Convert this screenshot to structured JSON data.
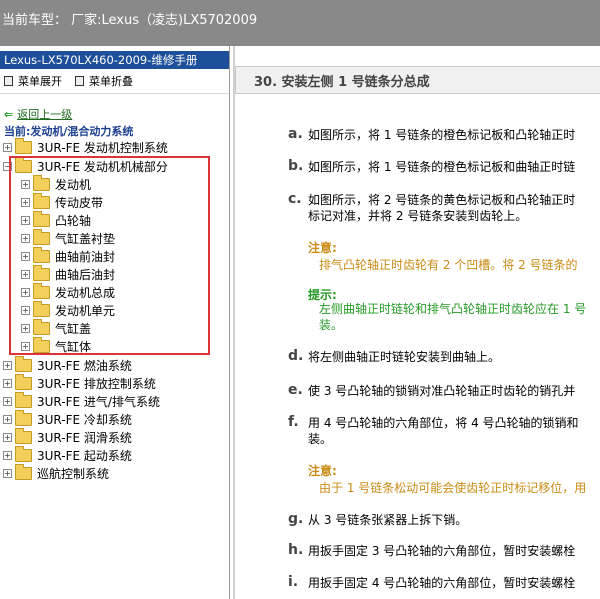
{
  "header": {
    "title": "当前车型： 厂家:Lexus（凌志)LX5702009"
  },
  "sidebar": {
    "manual_title": "Lexus-LX570LX460-2009-维修手册",
    "expand_label": "菜单展开",
    "collapse_label": "菜单折叠",
    "back_label": "返回上一级",
    "current_label": "当前:发动机/混合动力系统",
    "tree": [
      {
        "label": "3UR-FE 发动机控制系统"
      },
      {
        "label": "3UR-FE 发动机机械部分"
      },
      {
        "label": "发动机"
      },
      {
        "label": "传动皮带"
      },
      {
        "label": "凸轮轴"
      },
      {
        "label": "气缸盖衬垫"
      },
      {
        "label": "曲轴前油封"
      },
      {
        "label": "曲轴后油封"
      },
      {
        "label": "发动机总成"
      },
      {
        "label": "发动机单元"
      },
      {
        "label": "气缸盖"
      },
      {
        "label": "气缸体"
      },
      {
        "label": "3UR-FE 燃油系统"
      },
      {
        "label": "3UR-FE 排放控制系统"
      },
      {
        "label": "3UR-FE 进气/排气系统"
      },
      {
        "label": "3UR-FE 冷却系统"
      },
      {
        "label": "3UR-FE 润滑系统"
      },
      {
        "label": "3UR-FE 起动系统"
      },
      {
        "label": "巡航控制系统"
      }
    ]
  },
  "content": {
    "section_title": "30. 安装左侧 1 号链条分总成",
    "steps": [
      {
        "letter": "a.",
        "lines": [
          "如图所示，将 1 号链条的橙色标记板和凸轮轴正时"
        ]
      },
      {
        "letter": "b.",
        "lines": [
          "如图所示，将 1 号链条的橙色标记板和曲轴正时链"
        ]
      },
      {
        "letter": "c.",
        "lines": [
          "如图所示，将 2 号链条的黄色标记板和凸轮轴正时",
          "标记对准，并将 2 号链条安装到齿轮上。"
        ]
      },
      {
        "letter": "d.",
        "lines": [
          "将左侧曲轴正时链轮安装到曲轴上。"
        ]
      },
      {
        "letter": "e.",
        "lines": [
          "使 3 号凸轮轴的锁销对准凸轮轴正时齿轮的销孔并"
        ]
      },
      {
        "letter": "f.",
        "lines": [
          "用 4 号凸轮轴的六角部位，将 4 号凸轮轴的锁销和",
          "装。"
        ]
      },
      {
        "letter": "g.",
        "lines": [
          "从 3 号链条张紧器上拆下销。"
        ]
      },
      {
        "letter": "h.",
        "lines": [
          "用扳手固定 3 号凸轮轴的六角部位，暂时安装螺栓"
        ]
      },
      {
        "letter": "i.",
        "lines": [
          "用扳手固定 4 号凸轮轴的六角部位，暂时安装螺栓"
        ]
      }
    ],
    "note1": {
      "label": "注意:",
      "text": "排气凸轮轴正时齿轮有 2 个凹槽。将 2 号链条的"
    },
    "tip": {
      "label": "提示:",
      "lines": [
        "左侧曲轴正时链轮和排气凸轮轴正时齿轮应在 1 号",
        "装。"
      ]
    },
    "note2": {
      "label": "注意:",
      "text": "由于 1 号链条松动可能会使齿轮正时标记移位，用"
    }
  },
  "colors": {
    "header_bg": "#898989",
    "manual_bar": "#1d4f9a",
    "highlight_box": "#d9343a",
    "note": "#c98b16",
    "tip": "#269926"
  }
}
